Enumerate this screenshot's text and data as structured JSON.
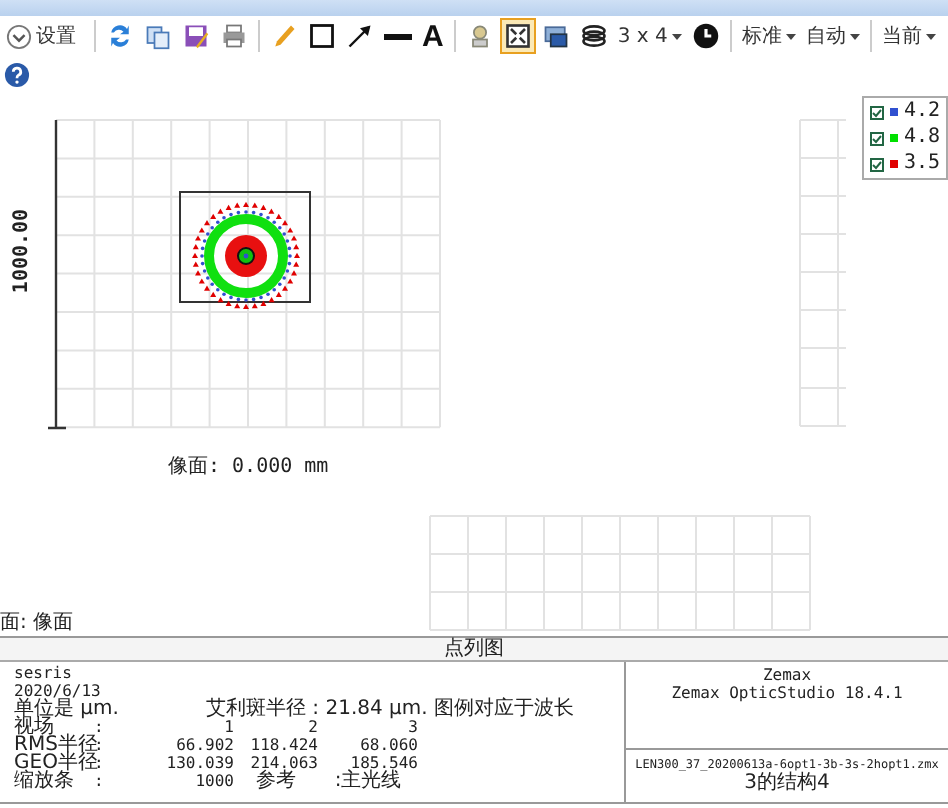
{
  "toolbar": {
    "items": [
      {
        "kind": "button",
        "label": "设置"
      },
      {
        "kind": "separator"
      },
      {
        "kind": "icon",
        "selected": false
      },
      {
        "kind": "icon",
        "selected": false
      },
      {
        "kind": "icon",
        "selected": false
      },
      {
        "kind": "icon",
        "selected": false
      },
      {
        "kind": "separator"
      },
      {
        "kind": "icon",
        "selected": false
      },
      {
        "kind": "icon",
        "selected": false
      },
      {
        "kind": "icon",
        "selected": false
      },
      {
        "kind": "icon",
        "selected": false
      },
      {
        "kind": "text-tool",
        "label": "A"
      },
      {
        "kind": "separator"
      },
      {
        "kind": "icon",
        "selected": false
      },
      {
        "kind": "icon",
        "selected": true
      },
      {
        "kind": "icon",
        "selected": false
      },
      {
        "kind": "icon",
        "selected": false
      },
      {
        "kind": "dropdown",
        "label": "3 x 4"
      },
      {
        "kind": "icon",
        "selected": false
      },
      {
        "kind": "separator"
      },
      {
        "kind": "dropdown",
        "label": "标准"
      },
      {
        "kind": "dropdown",
        "label": "自动"
      },
      {
        "kind": "separator"
      },
      {
        "kind": "dropdown",
        "label": "当前"
      }
    ]
  },
  "plot": {
    "y_axis_label": "1000.00",
    "x_axis_label": "像面: 0.000 mm",
    "legend": [
      {
        "label": "4.2",
        "checked": true,
        "color": "#3050d0"
      },
      {
        "label": "4.8",
        "checked": true,
        "color": "#00e000"
      },
      {
        "label": "3.5",
        "checked": true,
        "color": "#e00000"
      }
    ]
  },
  "surface_label": "面: 像面",
  "footer": {
    "title": "点列图",
    "lines": [
      "sesris",
      "2020/6/13"
    ],
    "unit": "单位是 µm.",
    "airy": "艾利斑半径 : 21.84 µm. 图例对应于波长",
    "rows": [
      {
        "cells": [
          "视场",
          ":",
          "1",
          "2",
          "3"
        ]
      },
      {
        "cells": [
          "RMS半径",
          ":",
          "66.902",
          "118.424",
          "68.060"
        ]
      },
      {
        "cells": [
          "GEO半径",
          ":",
          "130.039",
          "214.063",
          "185.546"
        ]
      },
      {
        "cells": [
          "缩放条",
          ":",
          "1000",
          "参考",
          ":主光线"
        ]
      }
    ],
    "company": "Zemax",
    "product": "Zemax OpticStudio 18.4.1",
    "file": "LEN300_37_20200613a-6opt1-3b-3s-2hopt1.zmx",
    "config": "3的结构4"
  }
}
